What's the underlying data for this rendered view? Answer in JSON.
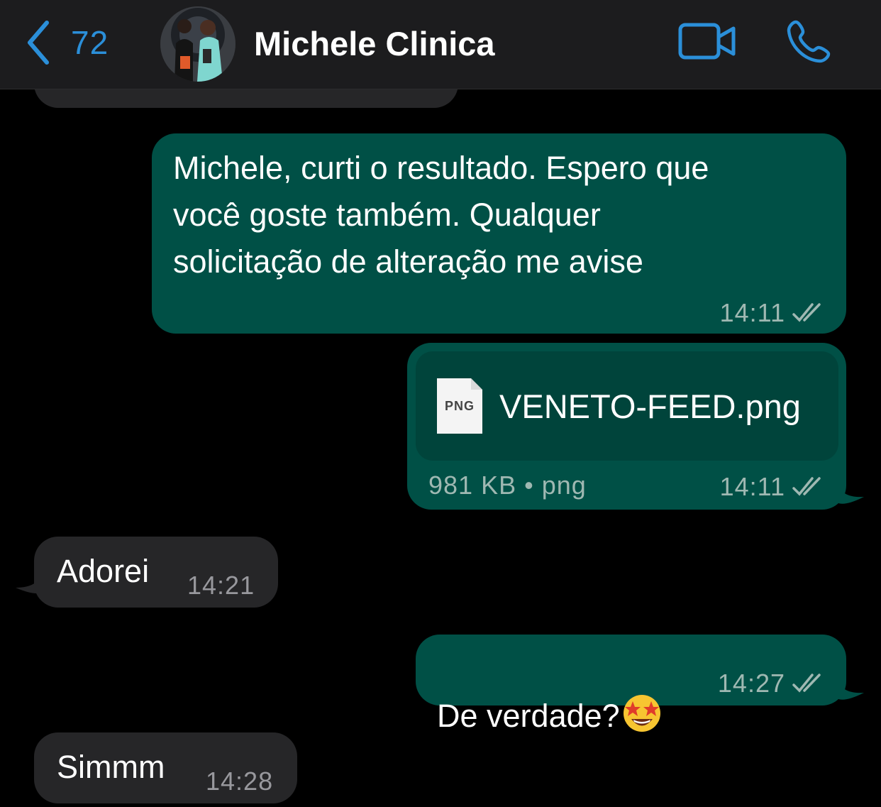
{
  "header": {
    "back_count": "72",
    "contact_name": "Michele Clinica",
    "accent": "#2b8fd9"
  },
  "messages": [
    {
      "direction": "outgoing",
      "text": "Michele, curti o resultado. Espero que\nvocê goste também. Qualquer\nsolicitação de alteração me avise",
      "time": "14:11",
      "status": "read"
    },
    {
      "direction": "outgoing",
      "type": "file",
      "file_badge": "PNG",
      "file_name": "VENETO-FEED.png",
      "file_info": "981 KB • png",
      "time": "14:11",
      "status": "read"
    },
    {
      "direction": "incoming",
      "text": "Adorei",
      "time": "14:21"
    },
    {
      "direction": "outgoing",
      "text": "De verdade?",
      "emoji": "star-struck",
      "time": "14:27",
      "status": "read"
    },
    {
      "direction": "incoming",
      "text": "Simmm",
      "time": "14:28"
    }
  ],
  "colors": {
    "outgoing_bubble": "#005046",
    "incoming_bubble": "#262628",
    "file_card": "#00443b",
    "background": "#000000",
    "header_bg": "#1c1c1e"
  }
}
